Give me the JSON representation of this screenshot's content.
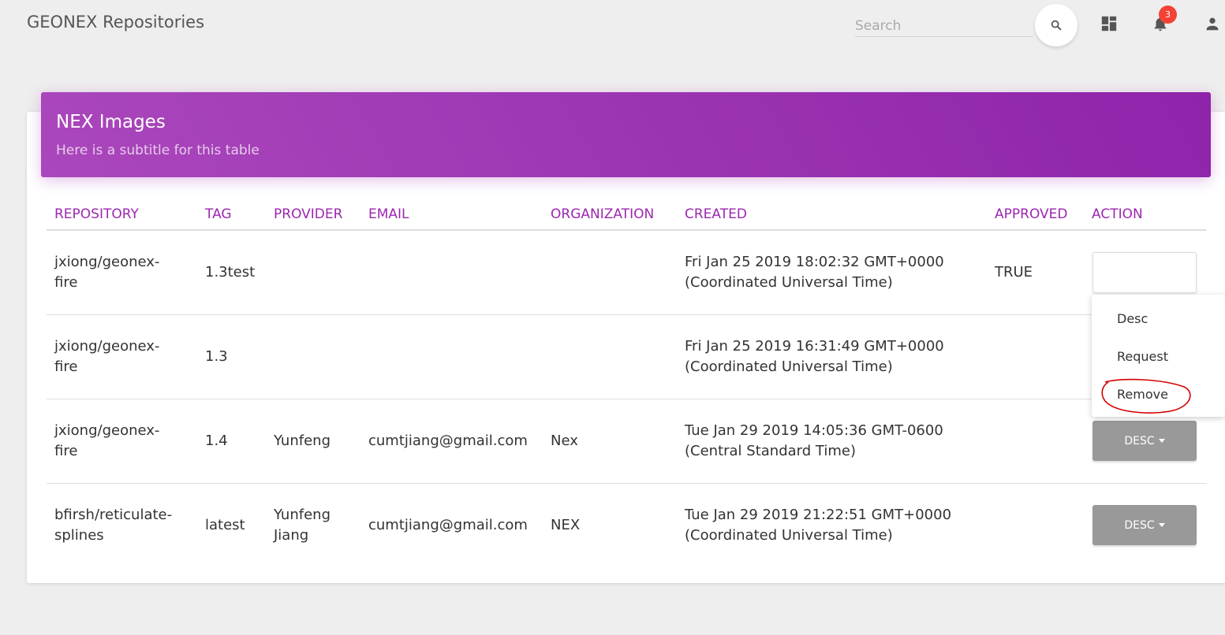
{
  "app": {
    "title": "GEONEX Repositories"
  },
  "topbar": {
    "search_placeholder": "Search",
    "search_icon": "search-icon",
    "dashboard_icon": "dashboard-icon",
    "notifications_icon": "bell-icon",
    "notification_count": "3",
    "user_icon": "person-icon",
    "badge_color": "#f44336"
  },
  "card": {
    "title": "NEX Images",
    "subtitle": "Here is a subtitle for this table",
    "accent_color": "#9c27b0"
  },
  "table": {
    "columns": [
      "REPOSITORY",
      "TAG",
      "PROVIDER",
      "EMAIL",
      "ORGANIZATION",
      "CREATED",
      "APPROVED",
      "ACTION"
    ],
    "rows": [
      {
        "repository": [
          "jxiong/geonex-",
          "fire"
        ],
        "tag": "1.3test",
        "provider": [],
        "email": "",
        "organization": "",
        "created": [
          "Fri Jan 25 2019 18:02:32 GMT+0000",
          "(Coordinated Universal Time)"
        ],
        "approved": "TRUE",
        "action": ""
      },
      {
        "repository": [
          "jxiong/geonex-",
          "fire"
        ],
        "tag": "1.3",
        "provider": [],
        "email": "",
        "organization": "",
        "created": [
          "Fri Jan 25 2019 16:31:49 GMT+0000",
          "(Coordinated Universal Time)"
        ],
        "approved": "",
        "action": ""
      },
      {
        "repository": [
          "jxiong/geonex-",
          "fire"
        ],
        "tag": "1.4",
        "provider": [
          "Yunfeng"
        ],
        "email": "cumtjiang@gmail.com",
        "organization": "Nex",
        "created": [
          "Tue Jan 29 2019 14:05:36 GMT-0600",
          "(Central Standard Time)"
        ],
        "approved": "",
        "action": "DESC"
      },
      {
        "repository": [
          "bfirsh/reticulate-",
          "splines"
        ],
        "tag": "latest",
        "provider": [
          "Yunfeng",
          "Jiang"
        ],
        "email": "cumtjiang@gmail.com",
        "organization": "NEX",
        "created": [
          "Tue Jan 29 2019 21:22:51 GMT+0000",
          "(Coordinated Universal Time)"
        ],
        "approved": "",
        "action": "DESC"
      }
    ]
  },
  "action_menu": {
    "items": [
      "Desc",
      "Request",
      "Remove"
    ],
    "highlighted_item": "Remove",
    "highlight_color": "#d40000"
  }
}
